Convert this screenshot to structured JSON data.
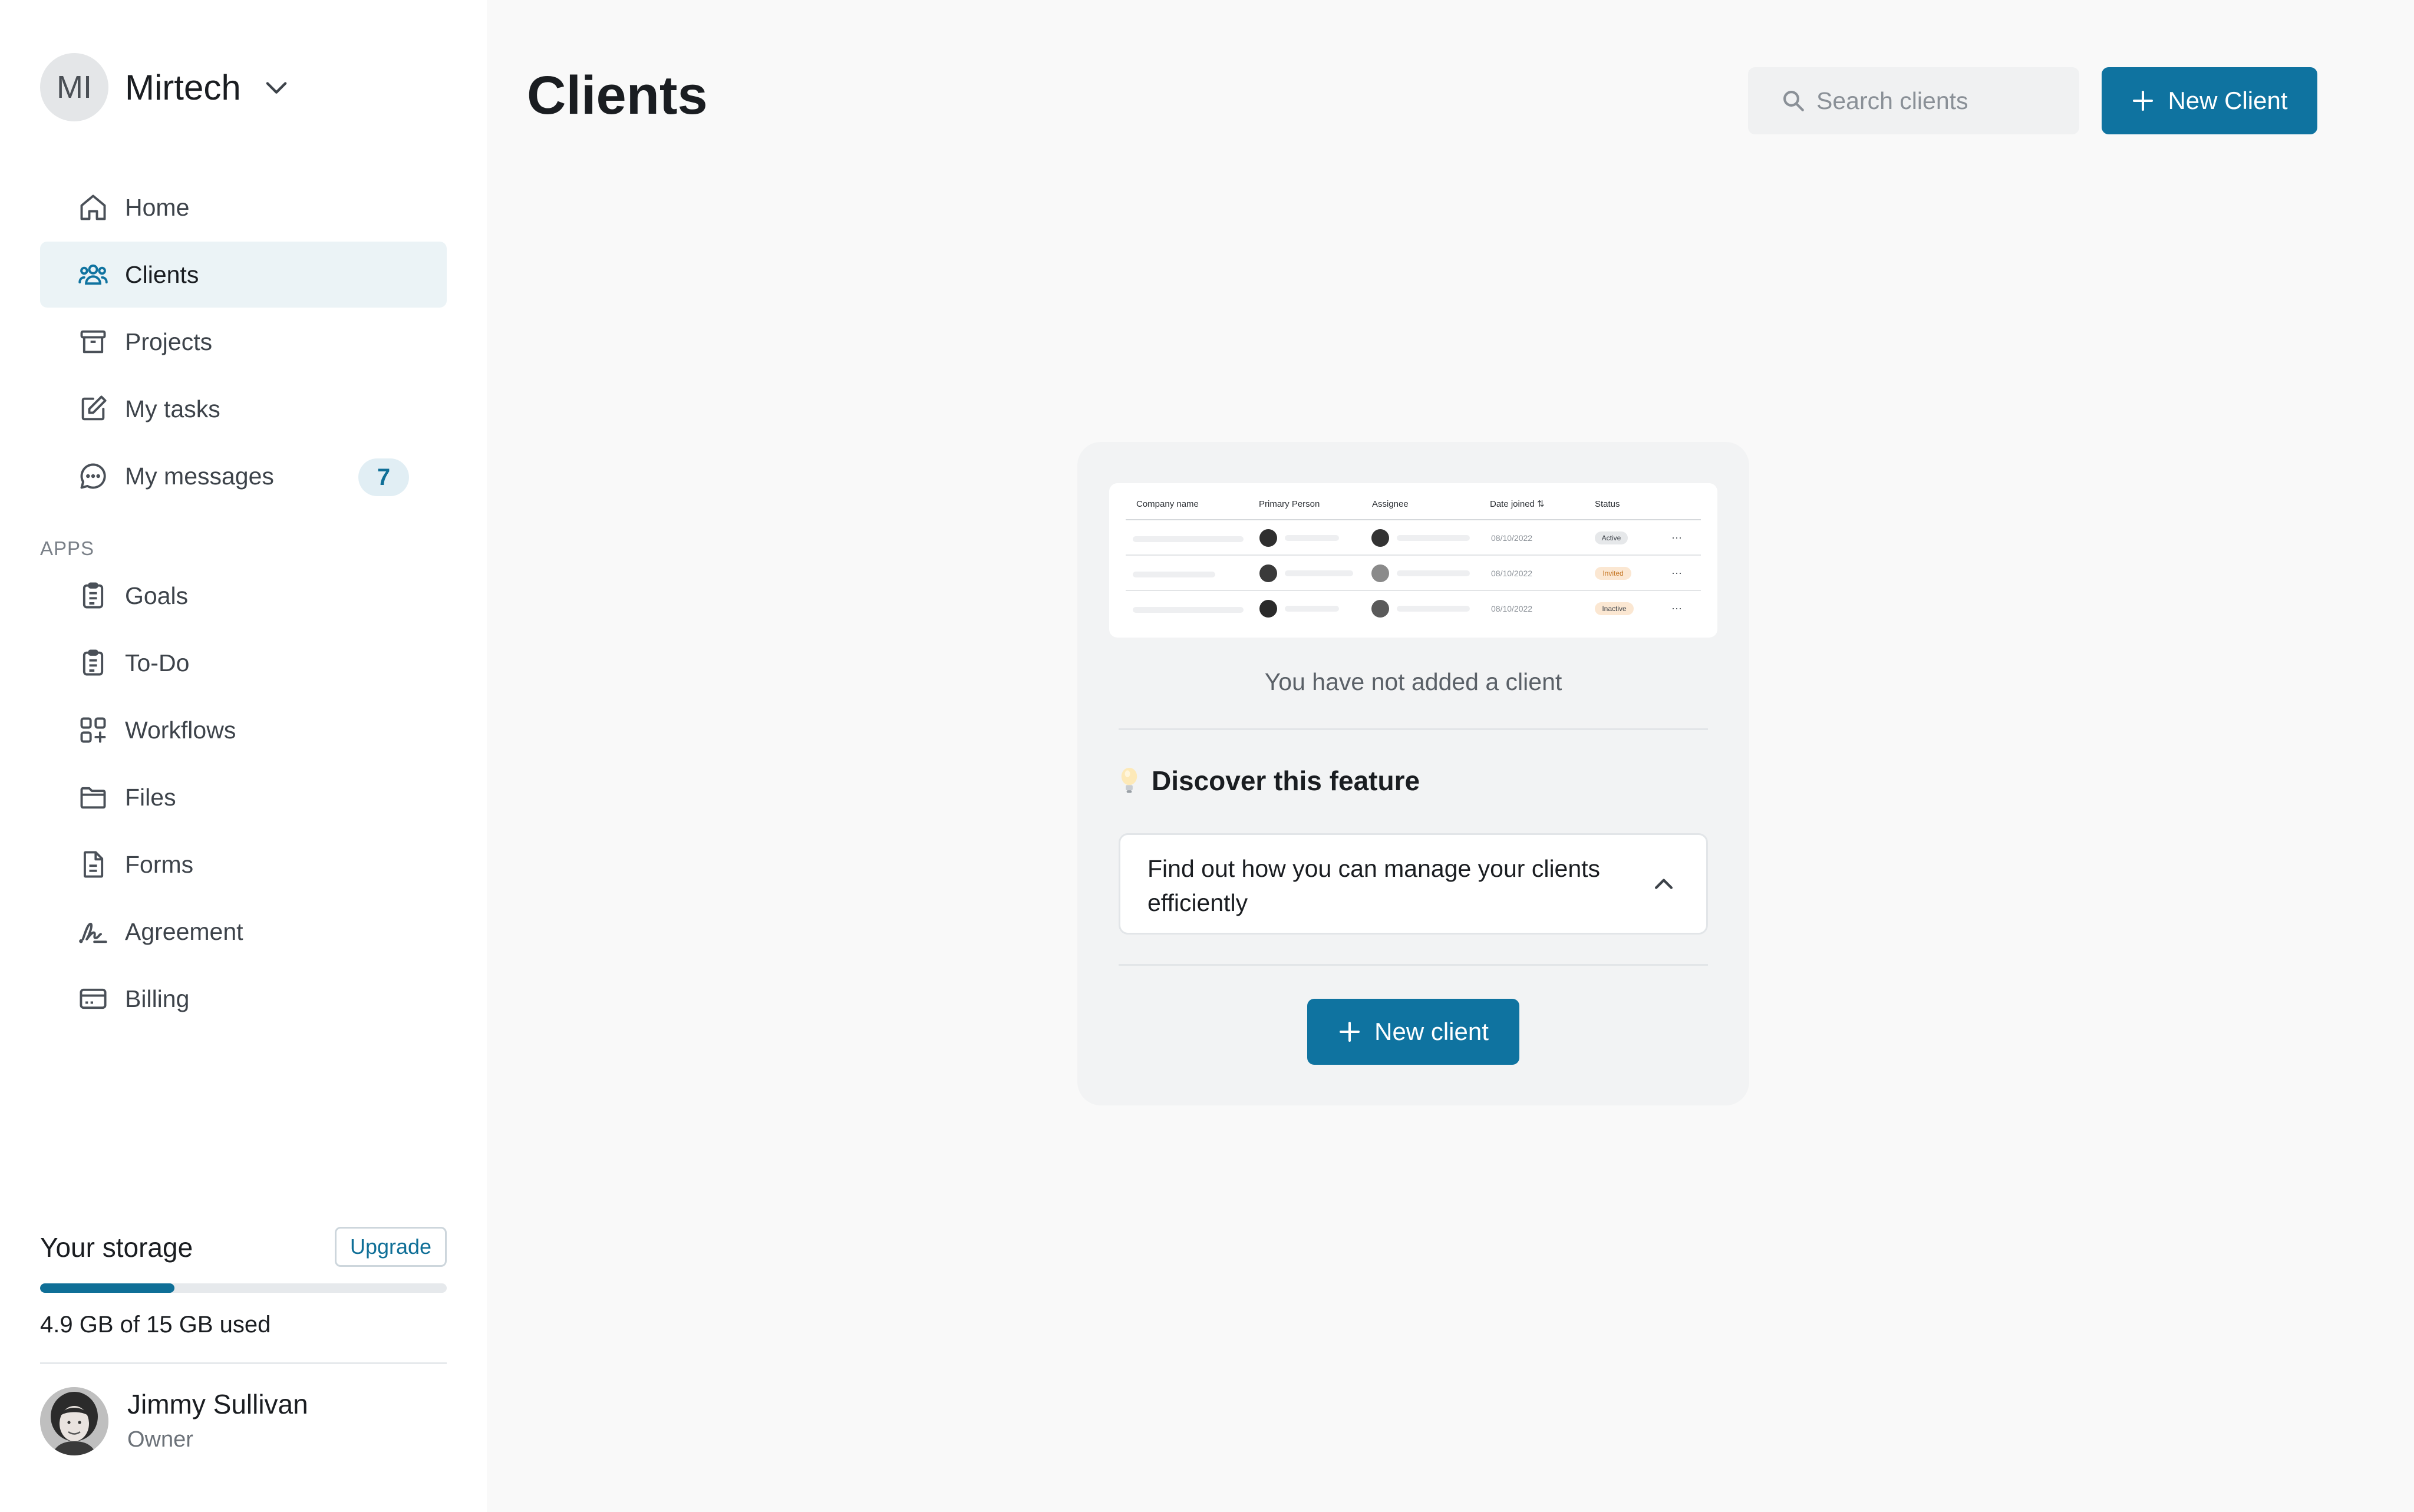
{
  "workspace": {
    "initials": "MI",
    "name": "Mirtech"
  },
  "nav": {
    "main": [
      {
        "label": "Home",
        "icon": "home-icon"
      },
      {
        "label": "Clients",
        "icon": "users-icon",
        "active": true
      },
      {
        "label": "Projects",
        "icon": "archive-icon"
      },
      {
        "label": "My tasks",
        "icon": "edit-icon"
      },
      {
        "label": "My messages",
        "icon": "message-icon",
        "badge": "7"
      }
    ],
    "apps_label": "APPS",
    "apps": [
      {
        "label": "Goals",
        "icon": "clipboard-icon"
      },
      {
        "label": "To-Do",
        "icon": "clipboard-icon"
      },
      {
        "label": "Workflows",
        "icon": "grid-plus-icon"
      },
      {
        "label": "Files",
        "icon": "folder-icon"
      },
      {
        "label": "Forms",
        "icon": "document-icon"
      },
      {
        "label": "Agreement",
        "icon": "signature-icon"
      },
      {
        "label": "Billing",
        "icon": "credit-card-icon"
      }
    ]
  },
  "storage": {
    "title": "Your storage",
    "upgrade_label": "Upgrade",
    "used_text": "4.9 GB of 15 GB used",
    "used_fraction": 0.33
  },
  "user": {
    "name": "Jimmy Sullivan",
    "role": "Owner"
  },
  "page": {
    "title": "Clients",
    "search_placeholder": "Search clients",
    "new_button_label": "New Client"
  },
  "empty_state": {
    "preview": {
      "headers": [
        "Company name",
        "Primary Person",
        "Assignee",
        "Date joined ⇅",
        "Status"
      ],
      "rows": [
        {
          "date": "08/10/2022",
          "status": "Active"
        },
        {
          "date": "08/10/2022",
          "status": "Invited"
        },
        {
          "date": "08/10/2022",
          "status": "Inactive"
        }
      ],
      "more": "···"
    },
    "message": "You have not added a client",
    "discover_title": "Discover this feature",
    "accordion_question": "Find out how you can manage your clients efficiently",
    "new_button_label": "New client"
  },
  "colors": {
    "primary": "#0f73a0",
    "active_bg": "#ebf3f6",
    "badge_bg": "#e1eef4"
  }
}
